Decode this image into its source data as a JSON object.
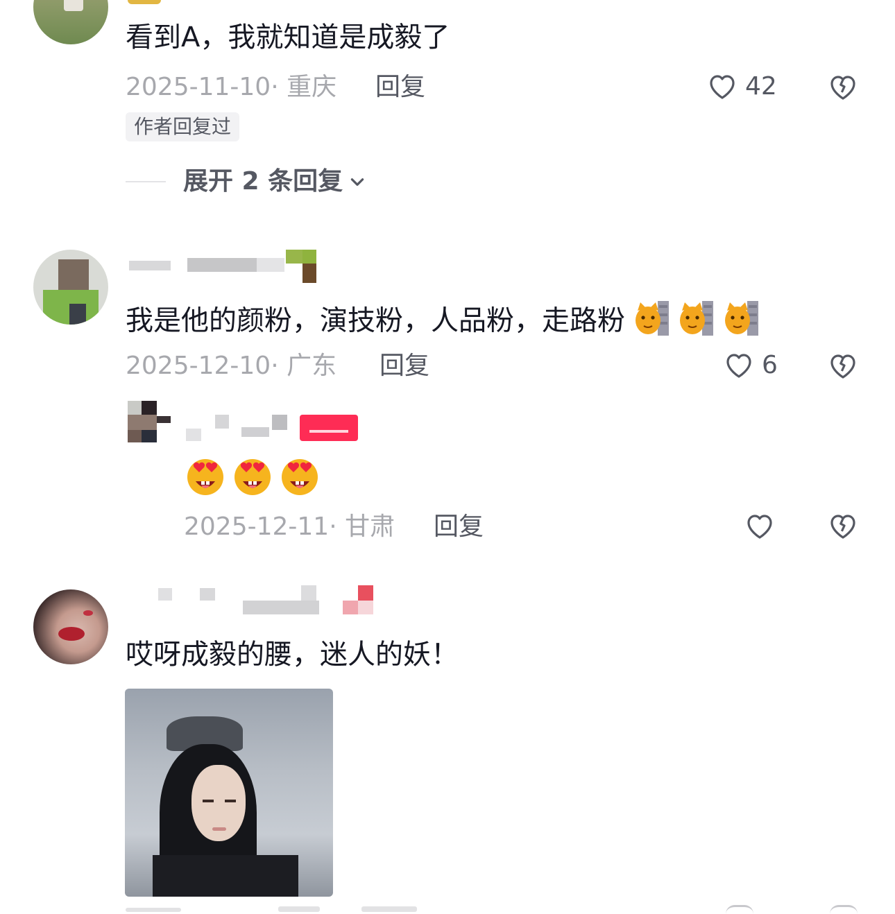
{
  "comments": [
    {
      "text": "看到A，我就知道是成毅了",
      "date": "2025-11-10",
      "location": "· 重庆",
      "reply_label": "回复",
      "likes": "42",
      "tag": "作者回复过",
      "expand_label": "展开 2 条回复"
    },
    {
      "text": "我是他的颜粉，演技粉，人品粉，走路粉",
      "date": "2025-12-10",
      "location": "· 广东",
      "reply_label": "回复",
      "likes": "6",
      "emoji": "cat-face-emoji"
    },
    {
      "date": "2025-12-11",
      "location": "· 甘肃",
      "reply_label": "回复",
      "emoji": "heart-eyes-emoji"
    },
    {
      "text": "哎呀成毅的腰，迷人的妖！"
    }
  ],
  "colors": {
    "text": "#161823",
    "meta": "#a7a8ad",
    "action": "#555862",
    "author_badge": "#fe2c55"
  },
  "icons": [
    "heart-outline-icon",
    "broken-heart-icon",
    "chevron-down-icon"
  ]
}
